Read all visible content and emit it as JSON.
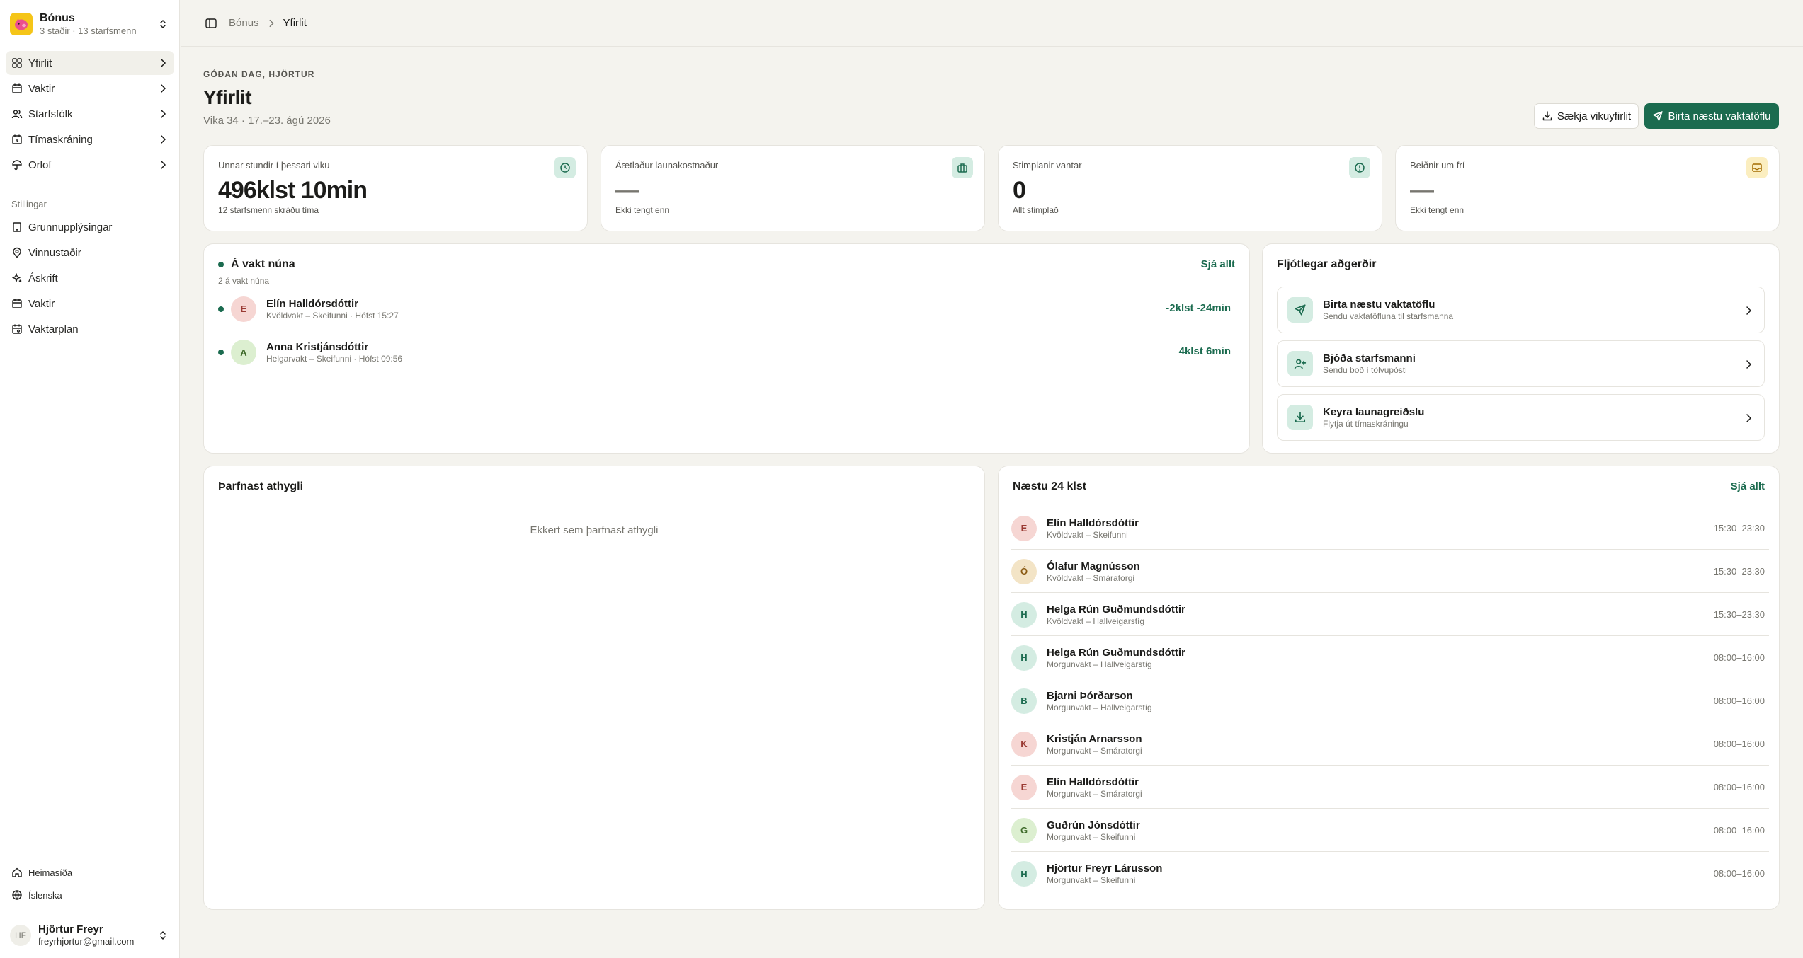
{
  "org": {
    "name": "Bónus",
    "subtitle": "3 staðir · 13 starfsmenn"
  },
  "nav": {
    "main": [
      {
        "label": "Yfirlit",
        "icon": "grid-icon"
      },
      {
        "label": "Vaktir",
        "icon": "calendar-icon"
      },
      {
        "label": "Starfsfólk",
        "icon": "users-icon"
      },
      {
        "label": "Tímaskráning",
        "icon": "clock-icon"
      },
      {
        "label": "Orlof",
        "icon": "umbrella-icon"
      }
    ],
    "settings_heading": "Stillingar",
    "settings": [
      {
        "label": "Grunnupplýsingar",
        "icon": "building-icon"
      },
      {
        "label": "Vinnustaðir",
        "icon": "map-pin-icon"
      },
      {
        "label": "Áskrift",
        "icon": "sparkles-icon"
      },
      {
        "label": "Vaktir",
        "icon": "calendar-icon"
      },
      {
        "label": "Vaktarplan",
        "icon": "calendar-cog-icon"
      }
    ],
    "footer": [
      {
        "label": "Heimasíða",
        "icon": "home-icon"
      },
      {
        "label": "Íslenska",
        "icon": "globe-icon"
      }
    ]
  },
  "user": {
    "initials": "HF",
    "name": "Hjörtur Freyr",
    "email": "freyrhjortur@gmail.com"
  },
  "breadcrumb": {
    "parent": "Bónus",
    "current": "Yfirlit"
  },
  "header": {
    "greeting": "GÓÐAN DAG, HJÖRTUR",
    "title": "Yfirlit",
    "subtitle": "Vika 34 · 17.–23. ágú 2026",
    "download_label": "Sækja vikuyfirlit",
    "publish_label": "Birta næstu vaktatöflu"
  },
  "stats": [
    {
      "label": "Unnar stundir í þessari viku",
      "value": "496klst 10min",
      "sub": "12 starfsmenn skráðu tíma",
      "icon": "clock-icon"
    },
    {
      "label": "Áætlaður launakostnaður",
      "value": "—",
      "sub": "Ekki tengt enn",
      "icon": "briefcase-icon"
    },
    {
      "label": "Stimplanir vantar",
      "value": "0",
      "sub": "Allt stimplað",
      "icon": "alert-circle-icon"
    },
    {
      "label": "Beiðnir um frí",
      "value": "—",
      "sub": "Ekki tengt enn",
      "icon": "inbox-icon"
    }
  ],
  "on_call": {
    "title": "Á vakt núna",
    "see_all": "Sjá allt",
    "subtitle": "2 á vakt núna",
    "people": [
      {
        "initial": "E",
        "name": "Elín Halldórsdóttir",
        "details": "Kvöldvakt – Skeifunni · Hófst 15:27",
        "duration": "-2klst -24min"
      },
      {
        "initial": "A",
        "name": "Anna Kristjánsdóttir",
        "details": "Helgarvakt – Skeifunni · Hófst 09:56",
        "duration": "4klst 6min"
      }
    ]
  },
  "quick_actions": {
    "title": "Fljótlegar aðgerðir",
    "items": [
      {
        "title": "Birta næstu vaktatöflu",
        "sub": "Sendu vaktatöfluna til starfsmanna",
        "icon": "send-icon"
      },
      {
        "title": "Bjóða starfsmanni",
        "sub": "Sendu boð í tölvupósti",
        "icon": "user-plus-icon"
      },
      {
        "title": "Keyra launagreiðslu",
        "sub": "Flytja út tímaskráningu",
        "icon": "download-icon"
      }
    ]
  },
  "attention": {
    "title": "Þarfnast athygli",
    "empty": "Ekkert sem þarfnast athygli"
  },
  "next24": {
    "title": "Næstu 24 klst",
    "see_all": "Sjá allt",
    "shifts": [
      {
        "initial": "E",
        "name": "Elín Halldórsdóttir",
        "details": "Kvöldvakt – Skeifunni",
        "time": "15:30–23:30"
      },
      {
        "initial": "Ó",
        "name": "Ólafur Magnússon",
        "details": "Kvöldvakt – Smáratorgi",
        "time": "15:30–23:30"
      },
      {
        "initial": "H",
        "name": "Helga Rún Guðmundsdóttir",
        "details": "Kvöldvakt – Hallveigarstíg",
        "time": "15:30–23:30"
      },
      {
        "initial": "H",
        "name": "Helga Rún Guðmundsdóttir",
        "details": "Morgunvakt – Hallveigarstíg",
        "time": "08:00–16:00"
      },
      {
        "initial": "B",
        "name": "Bjarni Þórðarson",
        "details": "Morgunvakt – Hallveigarstíg",
        "time": "08:00–16:00"
      },
      {
        "initial": "K",
        "name": "Kristján Arnarsson",
        "details": "Morgunvakt – Smáratorgi",
        "time": "08:00–16:00"
      },
      {
        "initial": "E",
        "name": "Elín Halldórsdóttir",
        "details": "Morgunvakt – Smáratorgi",
        "time": "08:00–16:00"
      },
      {
        "initial": "G",
        "name": "Guðrún Jónsdóttir",
        "details": "Morgunvakt – Skeifunni",
        "time": "08:00–16:00"
      },
      {
        "initial": "H",
        "name": "Hjörtur Freyr Lárusson",
        "details": "Morgunvakt – Skeifunni",
        "time": "08:00–16:00"
      }
    ]
  },
  "colors": {
    "accent": "#1b6b4f",
    "background": "#f4f3ee",
    "card": "#ffffff",
    "brand_yellow": "#f5c518"
  }
}
